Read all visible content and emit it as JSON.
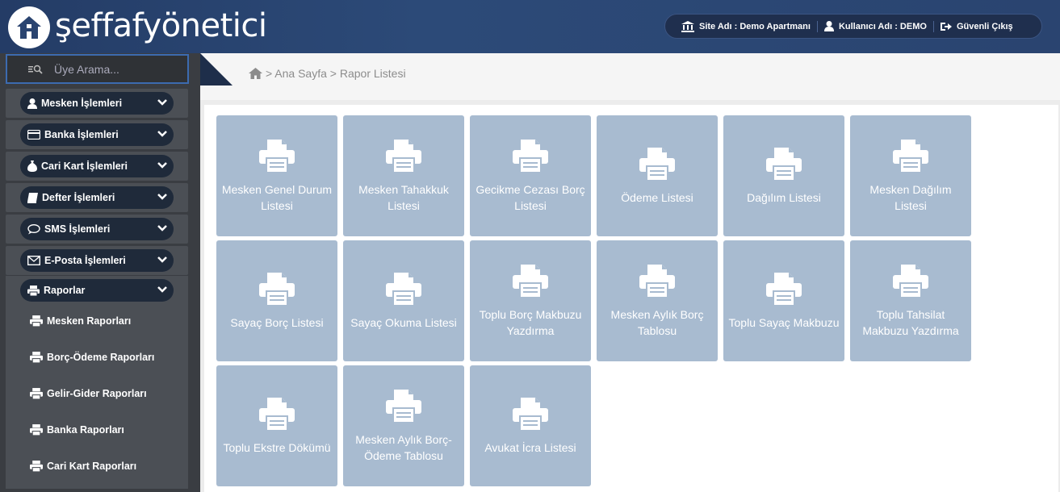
{
  "header": {
    "logo_text": "şeffafyönetici",
    "site_label": "Site Adı : Demo Apartmanı",
    "user_label": "Kullanıcı Adı : DEMO",
    "logout_label": "Güvenli Çıkış"
  },
  "sidebar": {
    "search_placeholder": "Üye Arama...",
    "menus": [
      {
        "label": "Mesken İşlemleri",
        "icon": "user-icon"
      },
      {
        "label": "Banka İşlemleri",
        "icon": "credit-card-icon"
      },
      {
        "label": "Cari Kart İşlemleri",
        "icon": "money-bag-icon"
      },
      {
        "label": "Defter İşlemleri",
        "icon": "book-icon"
      },
      {
        "label": "SMS İşlemleri",
        "icon": "chat-icon"
      },
      {
        "label": "E-Posta İşlemleri",
        "icon": "envelope-icon"
      },
      {
        "label": "Raporlar",
        "icon": "printer-icon"
      }
    ],
    "report_items": [
      "Mesken Raporları",
      "Borç-Ödeme Raporları",
      "Gelir-Gider Raporları",
      "Banka Raporları",
      "Cari Kart Raporları"
    ]
  },
  "breadcrumb": {
    "text": "> Ana Sayfa > Rapor Listesi"
  },
  "tiles": [
    {
      "l1": "Mesken Genel Durum",
      "l2": "Listesi"
    },
    {
      "l1": "Mesken Tahakkuk",
      "l2": "Listesi"
    },
    {
      "l1": "Gecikme Cezası Borç",
      "l2": "Listesi"
    },
    {
      "l1": "Ödeme Listesi",
      "l2": ""
    },
    {
      "l1": "Dağılım Listesi",
      "l2": ""
    },
    {
      "l1": "Mesken Dağılım",
      "l2": "Listesi"
    },
    {
      "l1": "Sayaç Borç Listesi",
      "l2": ""
    },
    {
      "l1": "Sayaç Okuma Listesi",
      "l2": ""
    },
    {
      "l1": "Toplu Borç Makbuzu",
      "l2": "Yazdırma"
    },
    {
      "l1": "Mesken Aylık Borç",
      "l2": "Tablosu"
    },
    {
      "l1": "Toplu Sayaç Makbuzu",
      "l2": ""
    },
    {
      "l1": "Toplu Tahsilat",
      "l2": "Makbuzu Yazdırma"
    },
    {
      "l1": "Toplu Ekstre Dökümü",
      "l2": ""
    },
    {
      "l1": "Mesken Aylık Borç-",
      "l2": "Ödeme Tablosu"
    },
    {
      "l1": "Avukat İcra Listesi",
      "l2": ""
    }
  ],
  "colors": {
    "header_bg": "#2a4470",
    "sidebar_bg": "#3a3d42",
    "pill_bg": "#1f2a3a",
    "tile_bg": "#a8bbd0"
  }
}
